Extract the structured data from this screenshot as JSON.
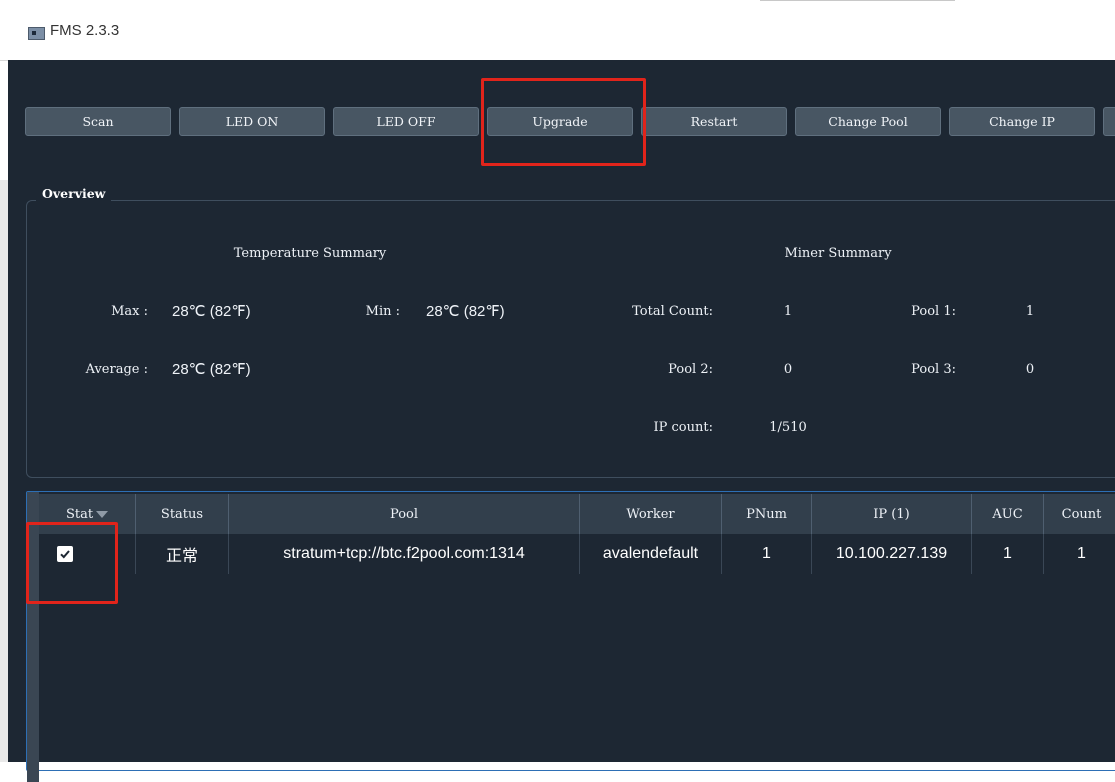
{
  "window": {
    "title": "FMS 2.3.3"
  },
  "toolbar": {
    "buttons": [
      "Scan",
      "LED ON",
      "LED OFF",
      "Upgrade",
      "Restart",
      "Change Pool",
      "Change IP"
    ]
  },
  "overview": {
    "group_label": "Overview",
    "temperature": {
      "title": "Temperature Summary",
      "max_label": "Max :",
      "max_value": "28℃ (82℉)",
      "min_label": "Min :",
      "min_value": "28℃ (82℉)",
      "avg_label": "Average :",
      "avg_value": "28℃ (82℉)"
    },
    "miner": {
      "title": "Miner Summary",
      "total_label": "Total Count:",
      "total_value": "1",
      "pool1_label": "Pool 1:",
      "pool1_value": "1",
      "pool2_label": "Pool 2:",
      "pool2_value": "0",
      "pool3_label": "Pool 3:",
      "pool3_value": "0",
      "ip_label": "IP count:",
      "ip_value": "1/510"
    }
  },
  "table": {
    "headers": [
      "Stat",
      "Status",
      "Pool",
      "Worker",
      "PNum",
      "IP (1)",
      "AUC",
      "Count"
    ],
    "rows": [
      {
        "checked": true,
        "status": "正常",
        "pool": "stratum+tcp://btc.f2pool.com:1314",
        "worker": "avalendefault",
        "pnum": "1",
        "ip": "10.100.227.139",
        "auc": "1",
        "count": "1"
      }
    ]
  },
  "colors": {
    "app_bg": "#1d2733",
    "button_bg": "#485663",
    "highlight": "#e1241b",
    "selection_border": "#2d6fb5"
  }
}
